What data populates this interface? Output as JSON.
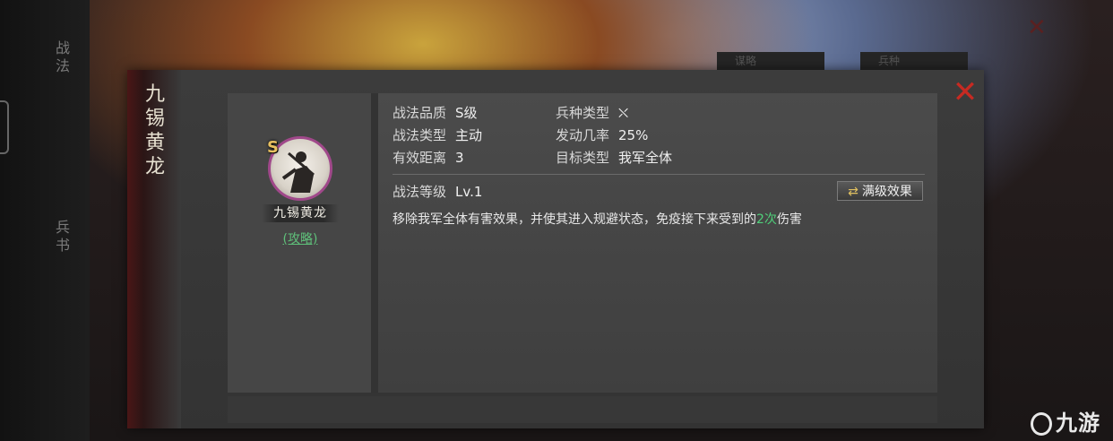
{
  "background": {
    "close_icon": "close-icon",
    "tab_labels": [
      "谋略",
      "兵种"
    ],
    "rail_labels": [
      "战法",
      "兵书"
    ]
  },
  "dialog": {
    "title": "九锡黄龙",
    "close_icon": "close-icon",
    "skill": {
      "grade": "S",
      "name_plate": "九锡黄龙",
      "strategy_link": "(攻略)",
      "portrait_icon": "warrior-portrait-icon"
    },
    "attributes": {
      "quality_label": "战法品质",
      "quality_value": "S级",
      "troop_label": "兵种类型",
      "troop_value": "⛌",
      "type_label": "战法类型",
      "type_value": "主动",
      "rate_label": "发动几率",
      "rate_value": "25%",
      "range_label": "有效距离",
      "range_value": "3",
      "target_label": "目标类型",
      "target_value": "我军全体",
      "level_label": "战法等级",
      "level_value": "Lv.1"
    },
    "full_effect_button": "满级效果",
    "description": {
      "before": "移除我军全体有害效果，并使其进入规避状态，免疫接下来受到的",
      "highlight": "2次",
      "after": "伤害"
    }
  },
  "watermark": {
    "text": "九游"
  },
  "colors": {
    "highlight_green": "#4fd07a",
    "close_red": "#c72a22",
    "grade_gold": "#e8c060",
    "portrait_ring": "#a0488a"
  }
}
